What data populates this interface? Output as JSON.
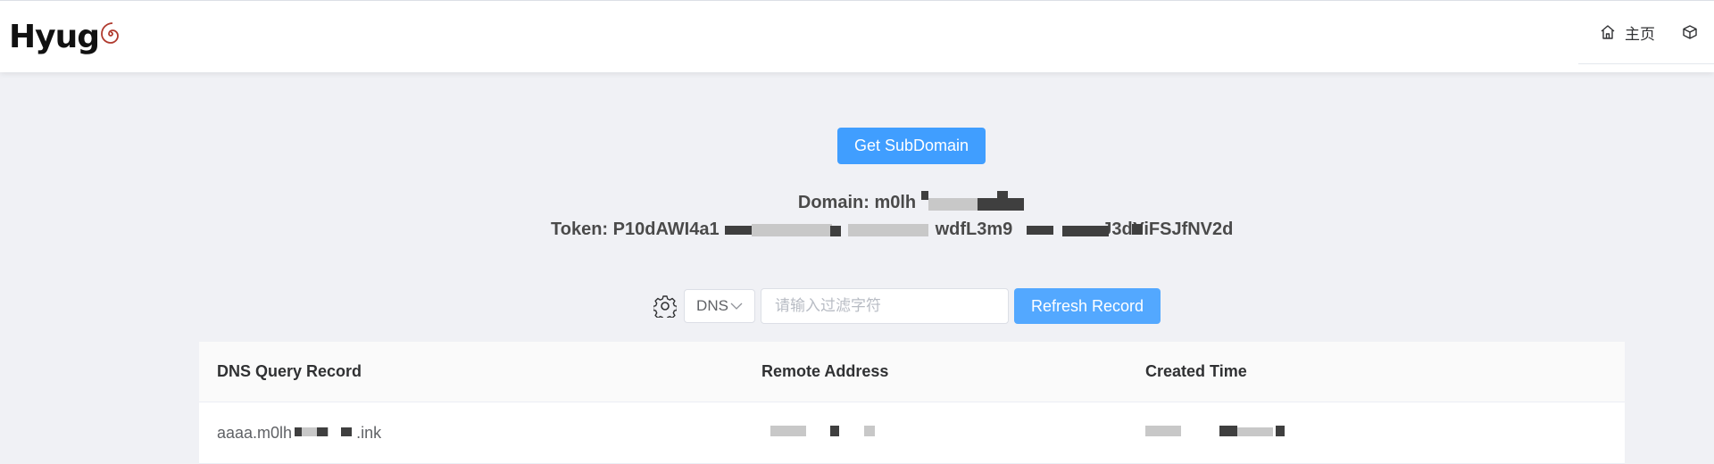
{
  "logo": {
    "text": "Hyug"
  },
  "nav": {
    "home_label": "主页"
  },
  "actions": {
    "get_subdomain": "Get SubDomain",
    "refresh_record": "Refresh Record"
  },
  "info": {
    "domain_label": "Domain:",
    "domain_value": "m0lh",
    "token_label": "Token:",
    "token_prefix": "P10dAWI4a1",
    "token_mid": "wdfL3m9",
    "token_suffix": "J3dYiFSJfNV2d"
  },
  "filter": {
    "type_selected": "DNS",
    "placeholder": "请输入过滤字符"
  },
  "table": {
    "columns": [
      "DNS Query Record",
      "Remote Address",
      "Created Time"
    ],
    "rows": [
      {
        "record_prefix": "aaaa.m0lh",
        "record_suffix": ".ink",
        "remote": "",
        "created": ""
      }
    ]
  },
  "colors": {
    "primary": "#409eff",
    "refresh": "#53a8ff",
    "background": "#f0f1f5"
  }
}
